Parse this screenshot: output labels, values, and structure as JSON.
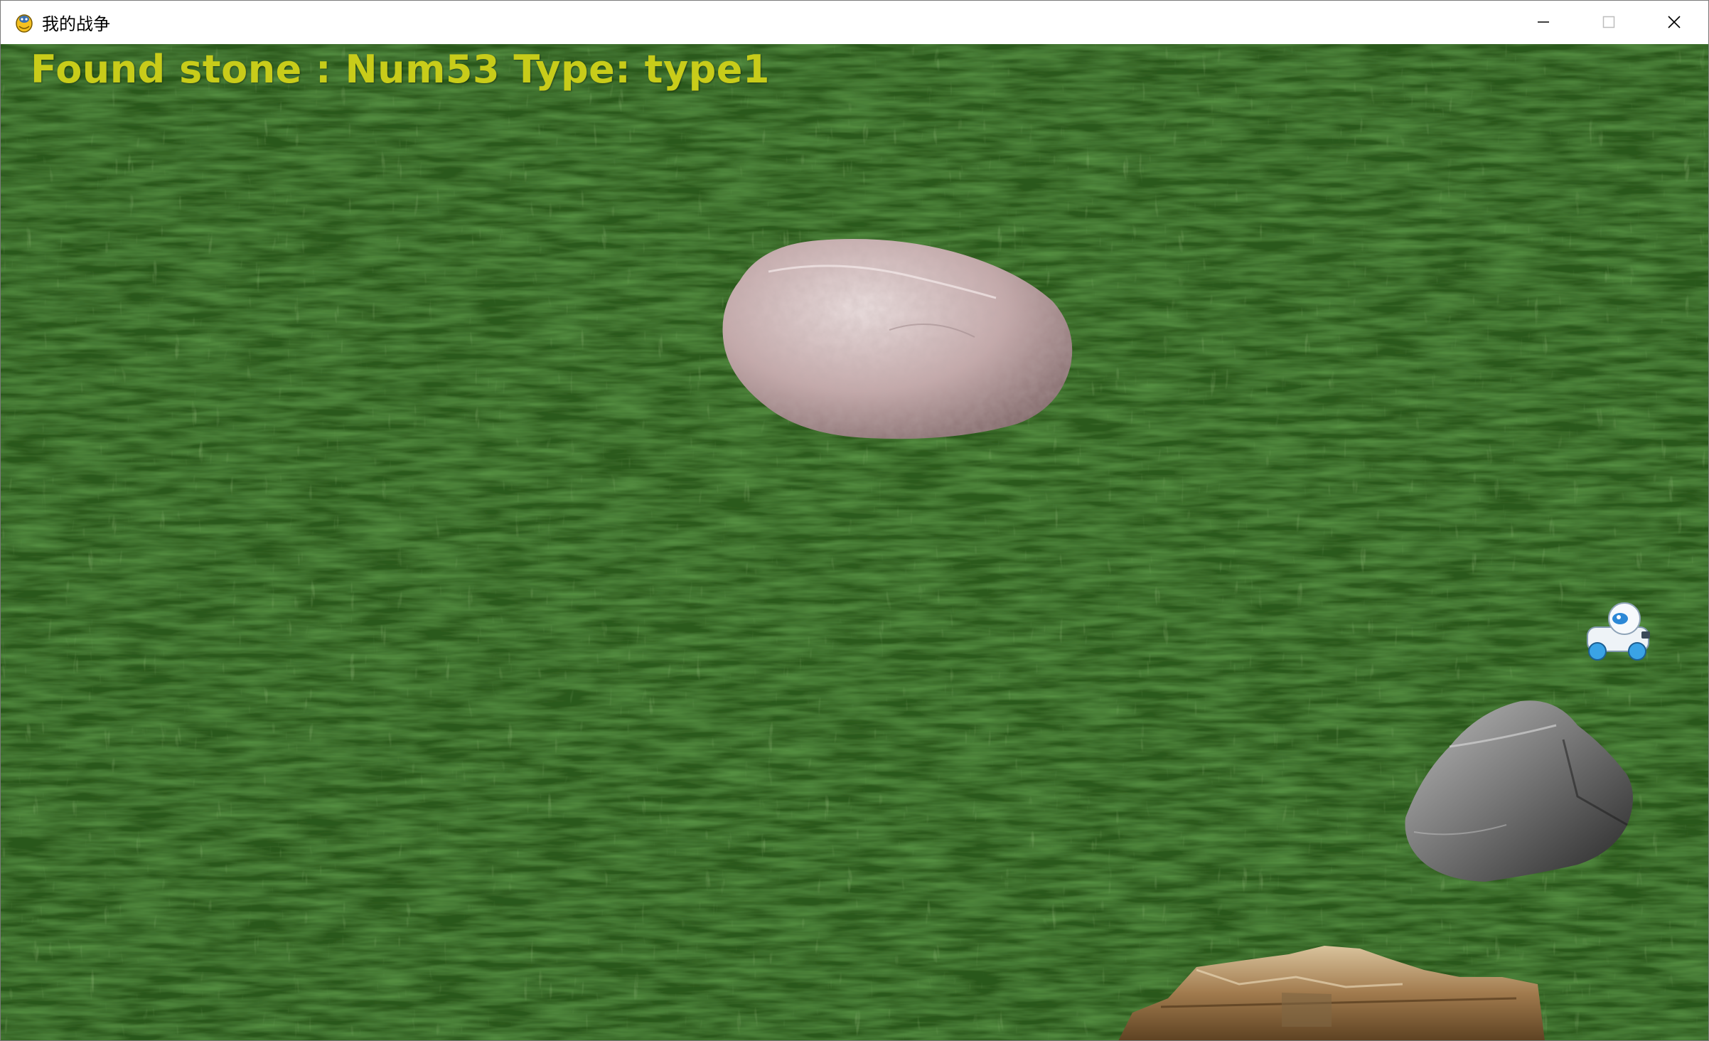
{
  "window": {
    "title": "我的战争",
    "app_icon": "pygame-snake-icon",
    "controls": {
      "minimize_icon": "minimize-icon",
      "maximize_icon": "maximize-icon",
      "close_icon": "close-icon"
    }
  },
  "hud": {
    "found_label": "Found stone : ",
    "stone_number": "Num53",
    "type_label": " Type: ",
    "stone_type": "type1",
    "text_color": "#c8cc1a"
  },
  "scene": {
    "background": "grass-field",
    "background_color": "#2f5a1f",
    "sprites": [
      {
        "name": "large-pink-stone",
        "kind": "stone"
      },
      {
        "name": "robot-rover",
        "kind": "player"
      },
      {
        "name": "gray-stone",
        "kind": "stone"
      },
      {
        "name": "layered-brown-rock",
        "kind": "stone"
      }
    ]
  }
}
